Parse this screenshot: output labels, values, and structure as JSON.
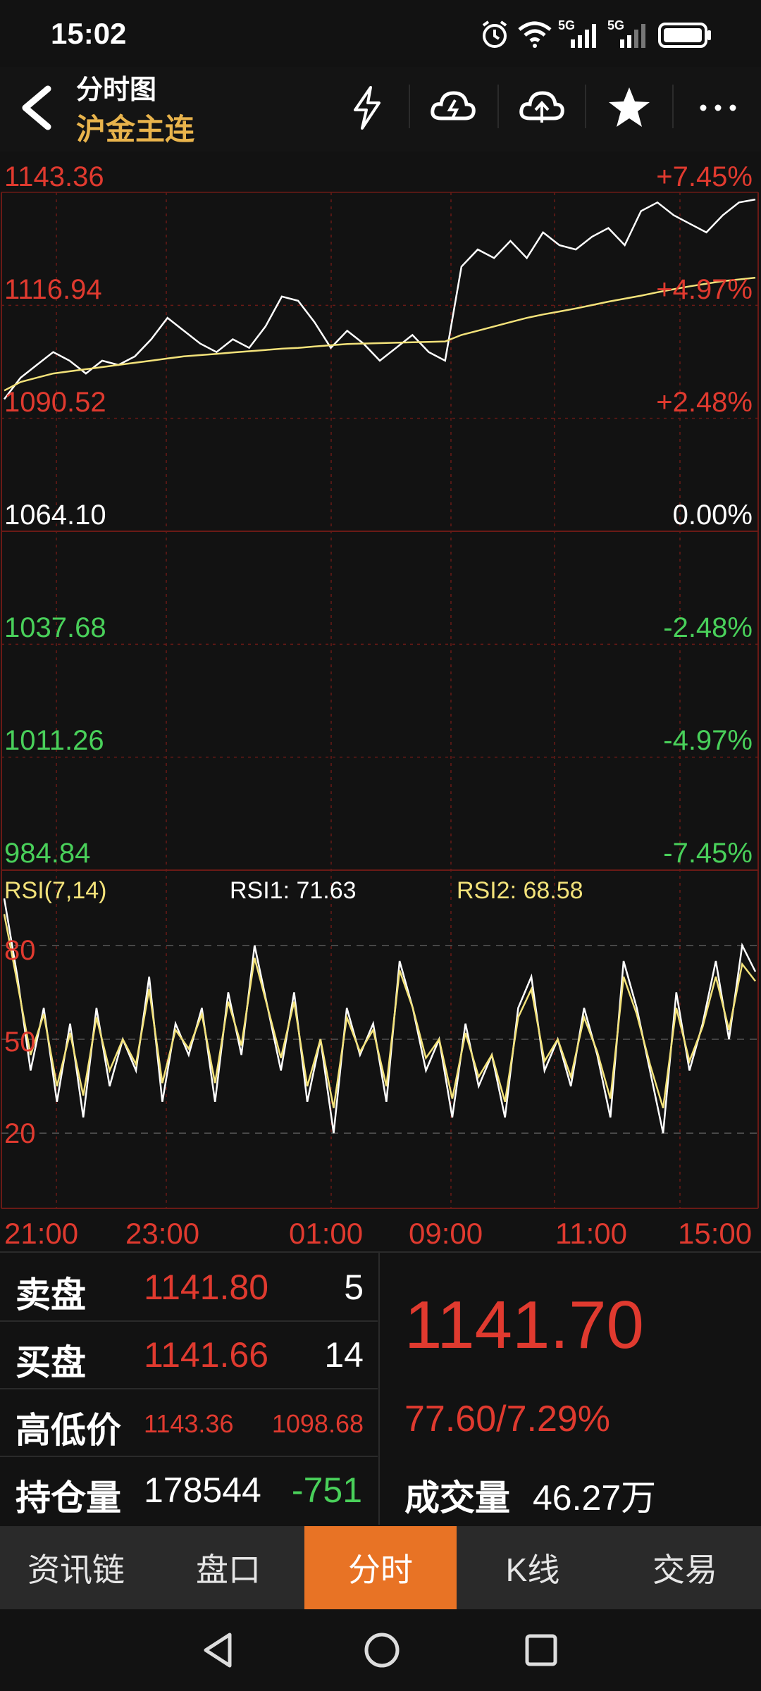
{
  "status_bar": {
    "time": "15:02",
    "signal1": "5G",
    "signal2": "5G"
  },
  "header": {
    "subtitle": "分时图",
    "title": "沪金主连"
  },
  "header_icons": [
    "flash-icon",
    "cloud-download-icon",
    "cloud-upload-icon",
    "star-icon",
    "more-icon"
  ],
  "chart_data": {
    "type": "line",
    "price_axis": {
      "left": [
        "1143.36",
        "1116.94",
        "1090.52",
        "1064.10",
        "1037.68",
        "1011.26",
        "984.84"
      ],
      "right": [
        "+7.45%",
        "+4.97%",
        "+2.48%",
        "0.00%",
        "-2.48%",
        "-4.97%",
        "-7.45%"
      ],
      "ylim": [
        984.84,
        1143.36
      ],
      "baseline": 1064.1
    },
    "time_labels": [
      "21:00",
      "23:00",
      "01:00",
      "09:00",
      "11:00",
      "15:00"
    ],
    "series": [
      {
        "name": "price",
        "color": "#ffffff",
        "values": [
          1095,
          1100,
          1103,
          1106,
          1104,
          1101,
          1104,
          1103,
          1105,
          1109,
          1114,
          1111,
          1108,
          1106,
          1109,
          1107,
          1112,
          1119,
          1118,
          1113,
          1107,
          1111,
          1108,
          1104,
          1107,
          1110,
          1106,
          1104,
          1126,
          1130,
          1128,
          1132,
          1128,
          1134,
          1131,
          1130,
          1133,
          1135,
          1131,
          1139,
          1141,
          1138,
          1136,
          1134,
          1138,
          1141,
          1141.7
        ]
      },
      {
        "name": "average",
        "color": "#f3e27a",
        "values": [
          1097,
          1099,
          1100,
          1101,
          1101.5,
          1102,
          1102.5,
          1103,
          1103.5,
          1104,
          1104.5,
          1105,
          1105.3,
          1105.6,
          1105.9,
          1106.2,
          1106.5,
          1106.8,
          1107,
          1107.3,
          1107.6,
          1107.9,
          1108,
          1108.1,
          1108.2,
          1108.3,
          1108.4,
          1108.5,
          1110,
          1111,
          1112,
          1113,
          1114,
          1114.8,
          1115.5,
          1116.2,
          1117,
          1117.8,
          1118.5,
          1119.2,
          1120,
          1120.7,
          1121.4,
          1122,
          1122.6,
          1123,
          1123.4
        ]
      }
    ],
    "rsi": {
      "label": "RSI(7,14)",
      "rsi1_label": "RSI1: 71.63",
      "rsi2_label": "RSI2: 68.58",
      "levels": [
        "80",
        "50",
        "20"
      ],
      "ylim": [
        0,
        100
      ],
      "rsi1": [
        95,
        70,
        40,
        60,
        30,
        55,
        25,
        60,
        35,
        50,
        40,
        70,
        30,
        55,
        45,
        60,
        30,
        65,
        45,
        80,
        60,
        40,
        65,
        30,
        50,
        20,
        60,
        45,
        55,
        30,
        75,
        60,
        40,
        50,
        25,
        55,
        35,
        45,
        25,
        60,
        70,
        40,
        50,
        35,
        60,
        45,
        25,
        75,
        60,
        40,
        20,
        65,
        40,
        55,
        75,
        50,
        80,
        71.63
      ],
      "rsi2": [
        90,
        68,
        45,
        58,
        35,
        52,
        32,
        57,
        40,
        50,
        42,
        66,
        36,
        53,
        47,
        58,
        36,
        62,
        48,
        76,
        60,
        44,
        62,
        35,
        50,
        28,
        57,
        46,
        53,
        35,
        72,
        60,
        44,
        50,
        31,
        52,
        38,
        45,
        30,
        57,
        66,
        43,
        50,
        38,
        57,
        46,
        31,
        70,
        58,
        42,
        28,
        60,
        43,
        54,
        70,
        53,
        74,
        68.58
      ]
    }
  },
  "quote": {
    "sell_label": "卖盘",
    "sell_price": "1141.80",
    "sell_qty": "5",
    "buy_label": "买盘",
    "buy_price": "1141.66",
    "buy_qty": "14",
    "hl_label": "高低价",
    "high": "1143.36",
    "low": "1098.68",
    "oi_label": "持仓量",
    "oi_value": "178544",
    "oi_change": "-751",
    "last_price": "1141.70",
    "change": "77.60/7.29%",
    "volume_label": "成交量",
    "volume_value": "46.27万"
  },
  "tabs": [
    {
      "label": "资讯链",
      "active": false
    },
    {
      "label": "盘口",
      "active": false
    },
    {
      "label": "分时",
      "active": true
    },
    {
      "label": "K线",
      "active": false
    },
    {
      "label": "交易",
      "active": false
    }
  ],
  "nav": [
    "back-nav-icon",
    "home-nav-icon",
    "recents-nav-icon"
  ]
}
